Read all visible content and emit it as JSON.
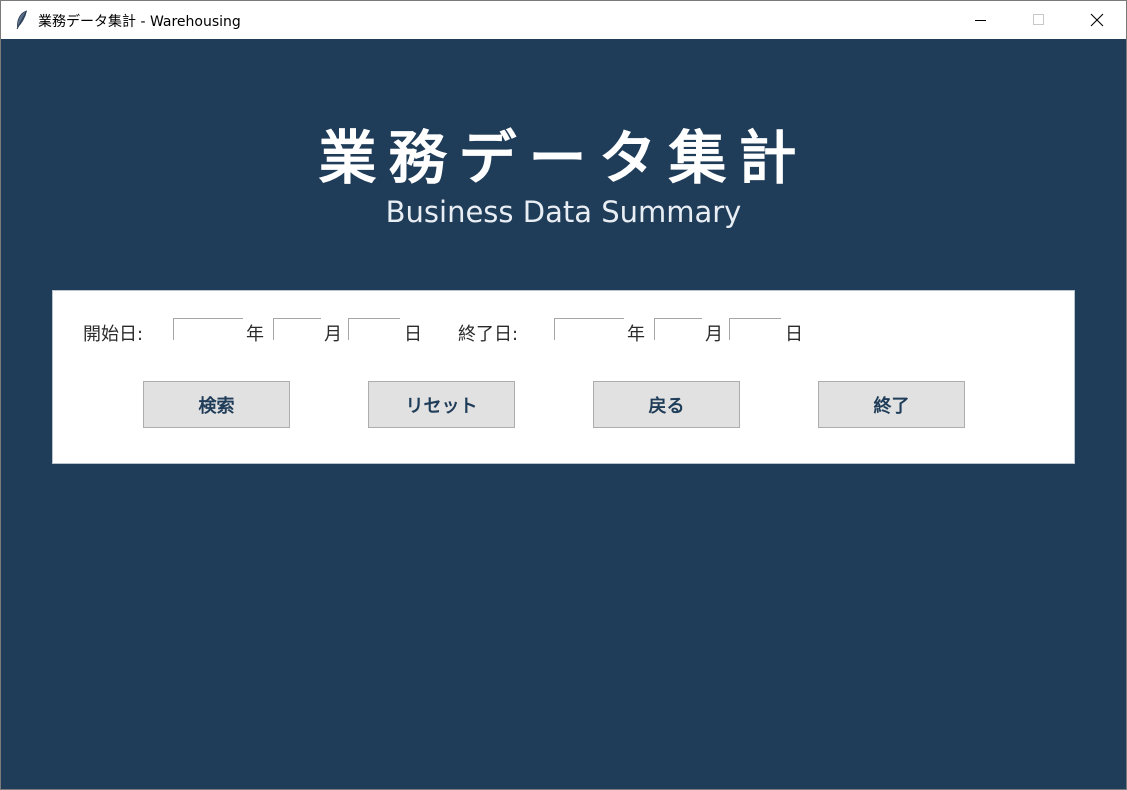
{
  "window": {
    "title": "業務データ集計 - Warehousing",
    "app_icon": "feather-icon",
    "controls": [
      "minimize-icon",
      "maximize-icon",
      "close-icon"
    ]
  },
  "header": {
    "title": "業務データ集計",
    "subtitle": "Business Data Summary"
  },
  "form": {
    "start": {
      "label": "開始日:",
      "year_value": "",
      "year_unit": "年",
      "month_value": "",
      "month_unit": "月",
      "day_value": "",
      "day_unit": "日"
    },
    "end": {
      "label": "終了日:",
      "year_value": "",
      "year_unit": "年",
      "month_value": "",
      "month_unit": "月",
      "day_value": "",
      "day_unit": "日"
    }
  },
  "buttons": {
    "search": "検索",
    "reset": "リセット",
    "back": "戻る",
    "exit": "終了"
  },
  "colors": {
    "background": "#1f3c58",
    "panel": "#ffffff",
    "button_face": "#e1e1e1",
    "button_text": "#1f3c58"
  }
}
